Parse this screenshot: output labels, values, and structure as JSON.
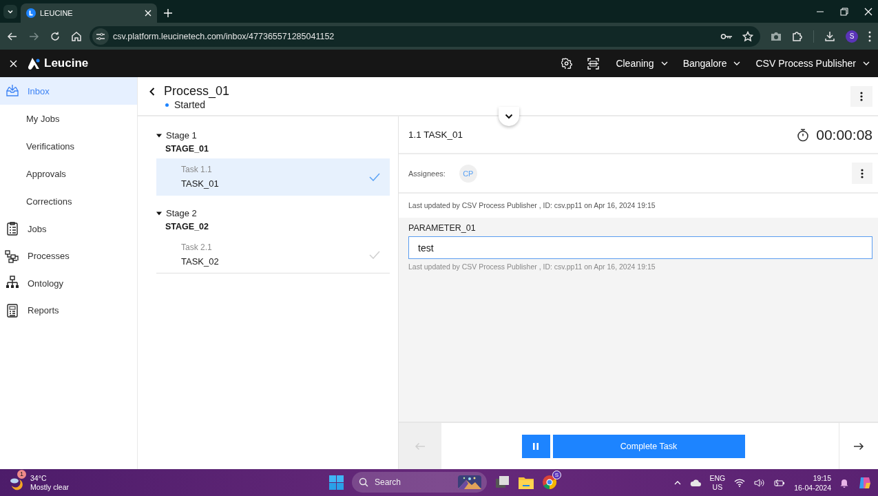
{
  "browser": {
    "tab_title": "LEUCINE",
    "url": "csv.platform.leucinetech.com/inbox/477365571285041152",
    "profile_initial": "S"
  },
  "app_header": {
    "logo": "Leucine",
    "menus": [
      {
        "label": "Cleaning"
      },
      {
        "label": "Bangalore"
      },
      {
        "label": "CSV Process Publisher"
      }
    ]
  },
  "sidebar": {
    "items": [
      {
        "label": "Inbox",
        "selected": true,
        "children": [
          {
            "label": "My Jobs",
            "selected": false
          },
          {
            "label": "Verifications",
            "selected": false
          },
          {
            "label": "Approvals",
            "selected": false
          },
          {
            "label": "Corrections",
            "selected": false
          }
        ]
      },
      {
        "label": "Jobs",
        "selected": false
      },
      {
        "label": "Processes",
        "selected": false
      },
      {
        "label": "Ontology",
        "selected": false
      },
      {
        "label": "Reports",
        "selected": false
      }
    ]
  },
  "process": {
    "title": "Process_01",
    "status": "Started"
  },
  "stages": [
    {
      "label": "Stage 1",
      "name": "STAGE_01",
      "expanded": true,
      "tasks": [
        {
          "label": "Task 1.1",
          "name": "TASK_01",
          "selected": true,
          "completed": true
        }
      ]
    },
    {
      "label": "Stage 2",
      "name": "STAGE_02",
      "expanded": true,
      "tasks": [
        {
          "label": "Task 2.1",
          "name": "TASK_02",
          "selected": false,
          "completed": false
        }
      ]
    }
  ],
  "task": {
    "title": "1.1 TASK_01",
    "timer": "00:00:08",
    "assignees_label": "Assignees:",
    "assignees": [
      "CP"
    ],
    "last_updated": "Last updated by CSV Process Publisher , ID: csv.pp11 on Apr 16, 2024 19:15",
    "parameters": [
      {
        "label": "PARAMETER_01",
        "value": "test",
        "last_updated": "Last updated by CSV Process Publisher , ID: csv.pp11 on Apr 16, 2024 19:15"
      }
    ]
  },
  "footer": {
    "previous_disabled": true,
    "complete_button": "Complete Task"
  },
  "taskbar": {
    "weather": {
      "badge": "1",
      "temperature": "34°C",
      "condition": "Mostly clear"
    },
    "search": "Search",
    "chrome_badge": "S",
    "language": "ENG",
    "region": "US",
    "time": "19:15",
    "date": "16-04-2024"
  }
}
